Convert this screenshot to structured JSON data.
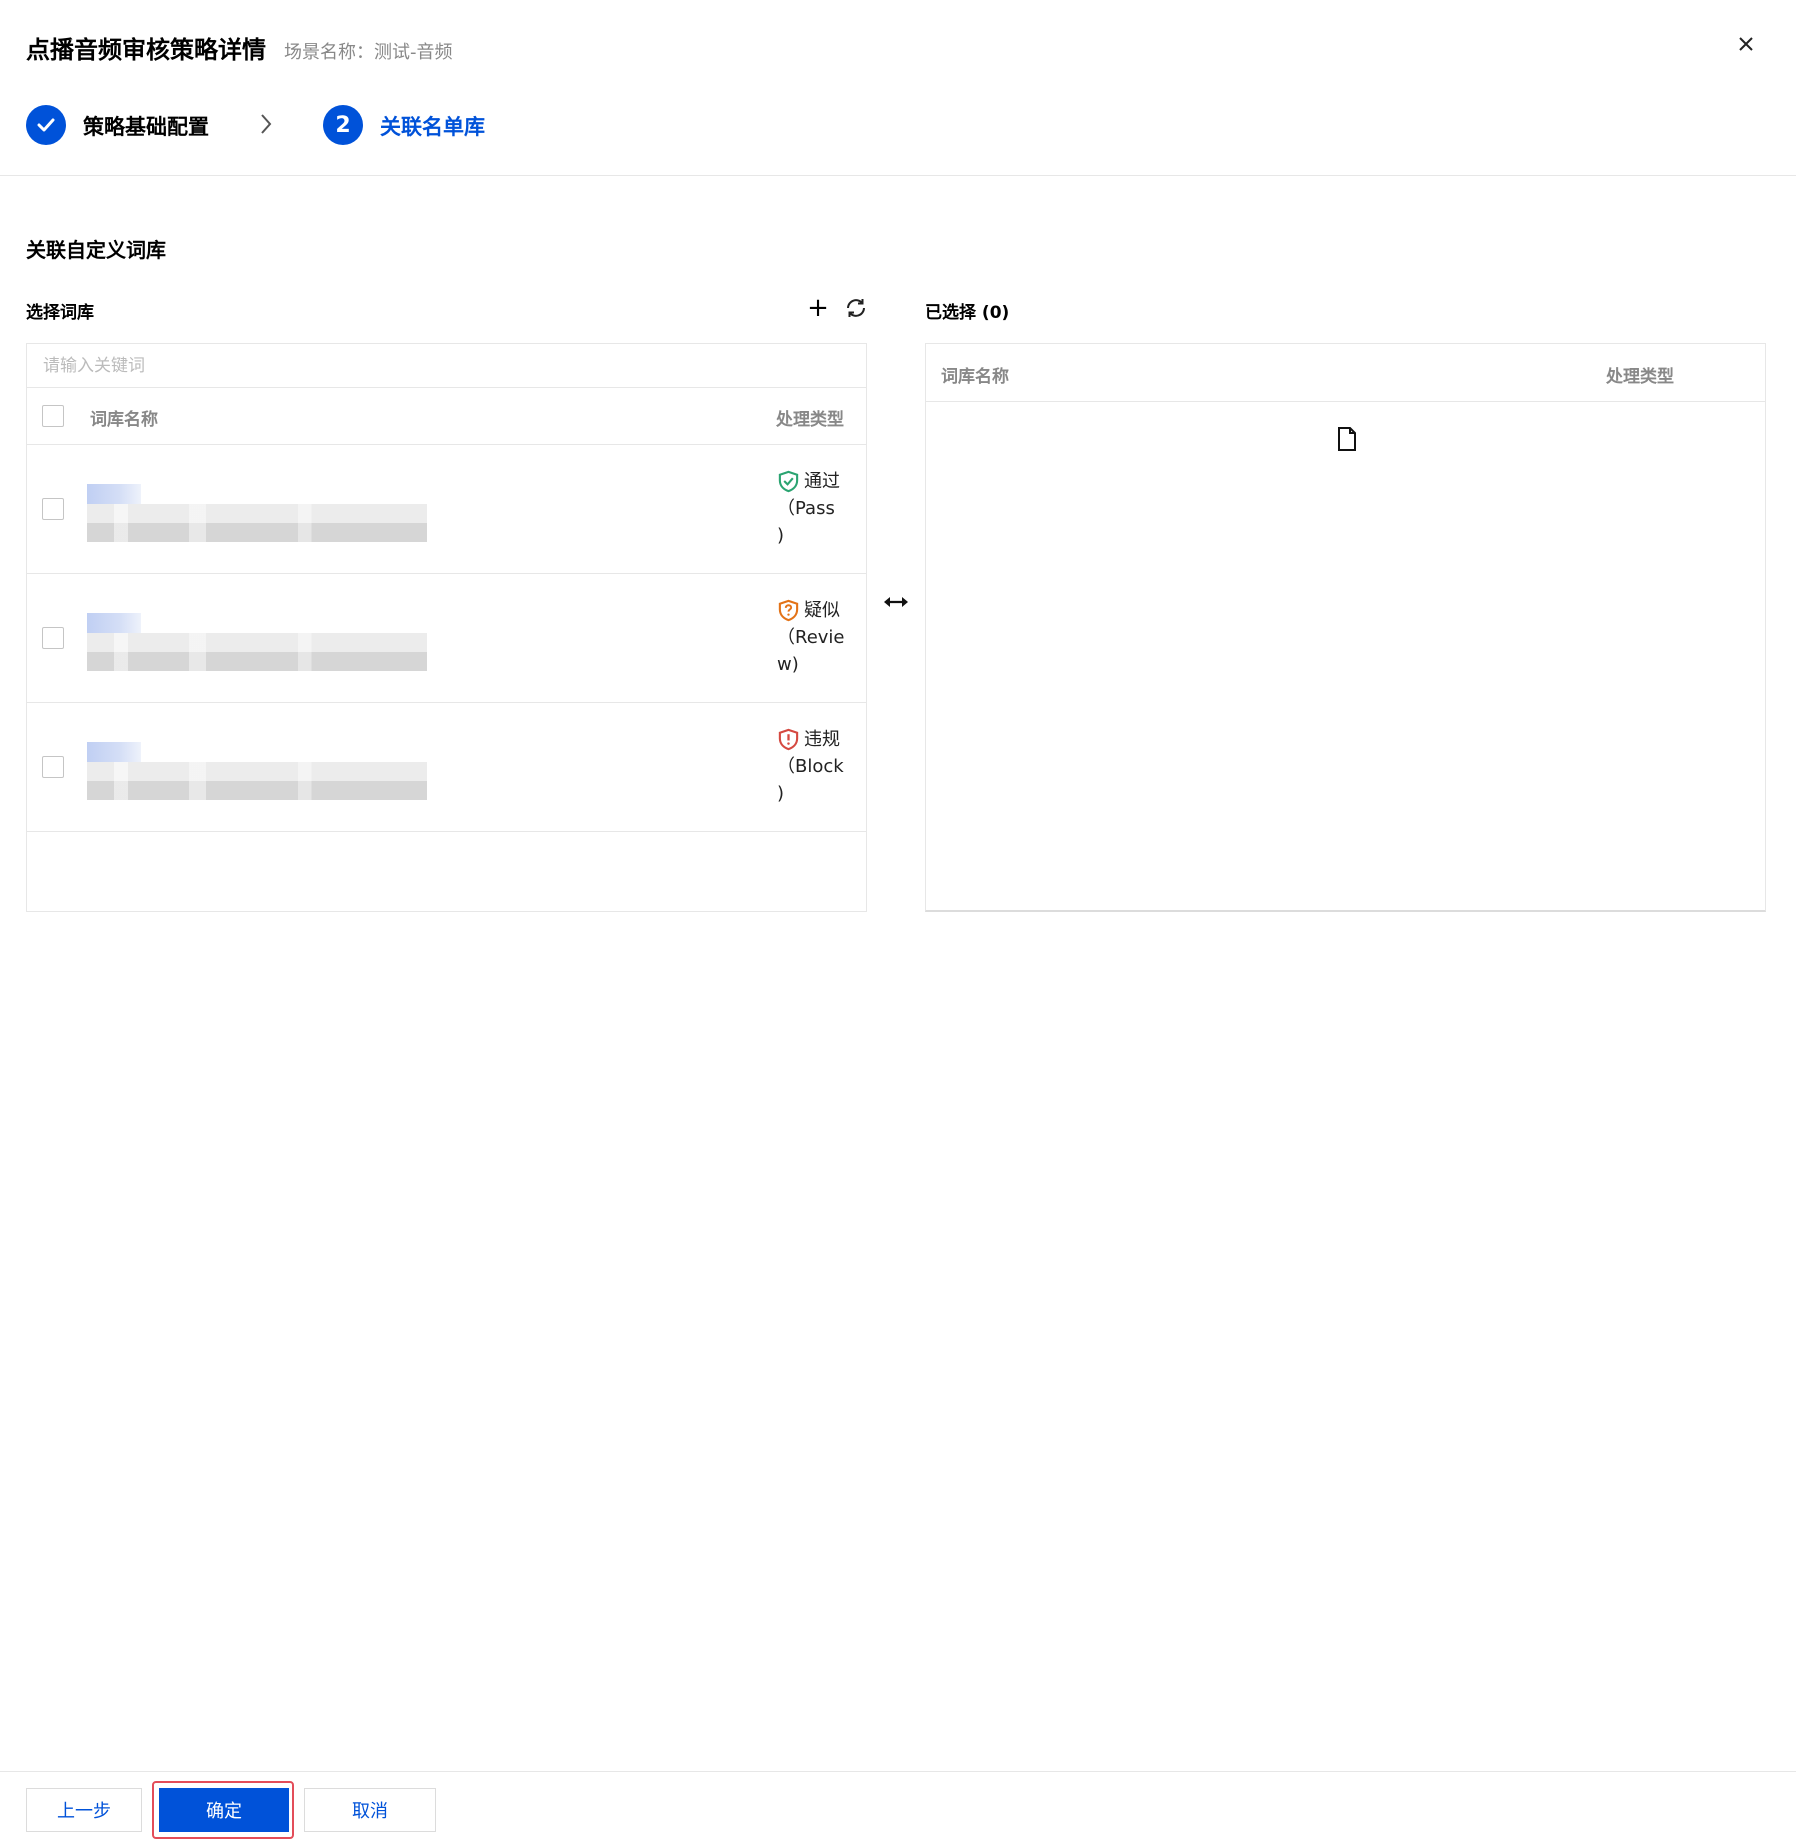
{
  "header": {
    "title": "点播音频审核策略详情",
    "subtitle": "场景名称：测试-音频",
    "close_icon": "close-icon"
  },
  "steps": [
    {
      "label": "策略基础配置",
      "state": "done",
      "icon": "check-icon"
    },
    {
      "label": "关联名单库",
      "number": "2",
      "state": "active"
    }
  ],
  "section": {
    "title": "关联自定义词库"
  },
  "left_panel": {
    "label": "选择词库",
    "add_icon": "plus-icon",
    "add_label": "+",
    "refresh_icon": "refresh-icon",
    "search_placeholder": "请输入关键词",
    "columns": {
      "name": "词库名称",
      "type": "处理类型"
    },
    "rows": [
      {
        "name": "",
        "type_label": "通过",
        "type_code": "（Pass",
        "type_tail": ")",
        "status": "pass",
        "color": "#2ba471"
      },
      {
        "name": "",
        "type_label": "疑似",
        "type_code": "（Revie",
        "type_tail": "w)",
        "status": "review",
        "color": "#e37318"
      },
      {
        "name": "",
        "type_label": "违规",
        "type_code": "（Block",
        "type_tail": ")",
        "status": "block",
        "color": "#d54941"
      }
    ]
  },
  "transfer_icon": "swap-horizontal-icon",
  "right_panel": {
    "label": "已选择 (0)",
    "columns": {
      "name": "词库名称",
      "type": "处理类型"
    },
    "empty_icon": "empty-file-icon"
  },
  "footer": {
    "prev_label": "上一步",
    "ok_label": "确定",
    "cancel_label": "取消"
  },
  "colors": {
    "primary": "#0052d9",
    "highlight_outline": "#e34d59"
  }
}
